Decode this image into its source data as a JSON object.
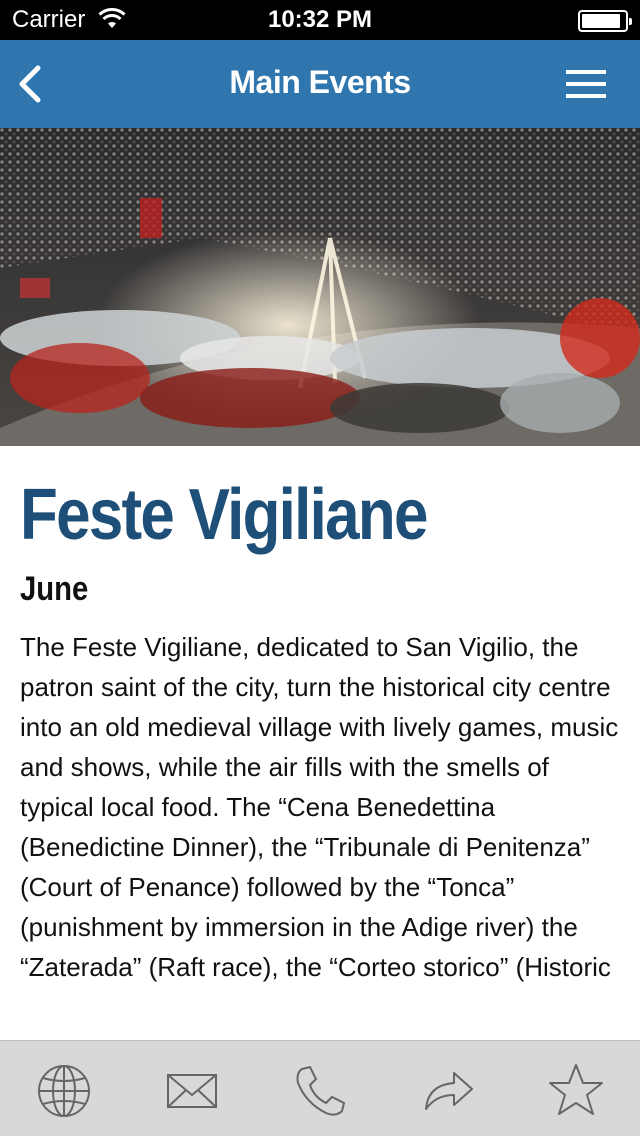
{
  "status_bar": {
    "carrier": "Carrier",
    "time": "10:32 PM",
    "battery_level": 0.9
  },
  "nav_bar": {
    "title": "Main Events",
    "back_icon": "chevron-left-icon",
    "menu_icon": "hamburger-menu-icon",
    "background_color": "#2f76ae"
  },
  "event": {
    "title": "Feste Vigiliane",
    "date": "June",
    "description": "The Feste Vigiliane, dedicated to San Vigilio, the patron saint of the city, turn the historical city centre into an old medieval village with lively games, music and shows, while the air fills with the smells of typical local food. The “Cena Benedettina (Benedictine Dinner), the “Tribunale di Penitenza” (Court of Penance) followed by the “Tonca” (punishment by immersion in the Adige river) the “Zaterada” (Raft race), the “Corteo storico” (Historic",
    "title_color": "#1e4f78"
  },
  "tab_bar": {
    "items": [
      {
        "icon": "globe-icon"
      },
      {
        "icon": "mail-icon"
      },
      {
        "icon": "phone-icon"
      },
      {
        "icon": "share-icon"
      },
      {
        "icon": "star-icon"
      }
    ]
  }
}
